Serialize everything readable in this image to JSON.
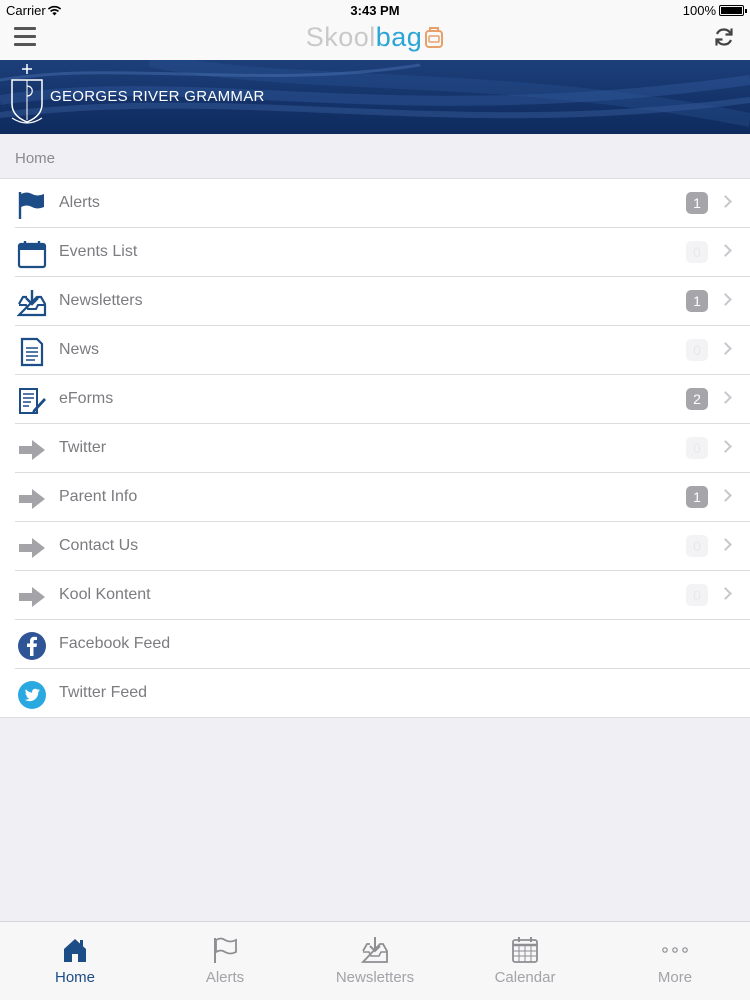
{
  "status_bar": {
    "carrier": "Carrier",
    "time": "3:43 PM",
    "battery": "100%"
  },
  "nav": {
    "brand_part1": "Skool",
    "brand_part2": "bag",
    "menu_icon": "hamburger-icon",
    "refresh_icon": "refresh-icon"
  },
  "banner": {
    "school_name": "GEORGES RIVER GRAMMAR"
  },
  "breadcrumb": "Home",
  "menu": {
    "items": [
      {
        "label": "Alerts",
        "icon": "flag-icon",
        "badge": "1"
      },
      {
        "label": "Events List",
        "icon": "calendar-icon",
        "badge": "0"
      },
      {
        "label": "Newsletters",
        "icon": "inbox-download-icon",
        "badge": "1"
      },
      {
        "label": "News",
        "icon": "document-icon",
        "badge": "0"
      },
      {
        "label": "eForms",
        "icon": "form-pencil-icon",
        "badge": "2"
      },
      {
        "label": "Twitter",
        "icon": "arrow-right-icon",
        "badge": "0"
      },
      {
        "label": "Parent Info",
        "icon": "arrow-right-icon",
        "badge": "1"
      },
      {
        "label": "Contact Us",
        "icon": "arrow-right-icon",
        "badge": "0"
      },
      {
        "label": "Kool Kontent",
        "icon": "arrow-right-icon",
        "badge": "0"
      },
      {
        "label": "Facebook Feed",
        "icon": "facebook-icon"
      },
      {
        "label": "Twitter Feed",
        "icon": "twitter-bird-icon"
      }
    ]
  },
  "tabs": [
    {
      "label": "Home",
      "icon": "home-icon",
      "active": true
    },
    {
      "label": "Alerts",
      "icon": "flag-icon"
    },
    {
      "label": "Newsletters",
      "icon": "inbox-download-icon"
    },
    {
      "label": "Calendar",
      "icon": "calendar-grid-icon"
    },
    {
      "label": "More",
      "icon": "more-dots-icon"
    }
  ],
  "colors": {
    "accent": "#1c4d86",
    "brand_blue": "#2aa5d6",
    "banner_navy": "#14336a",
    "badge_gray": "#a6a6aa"
  }
}
